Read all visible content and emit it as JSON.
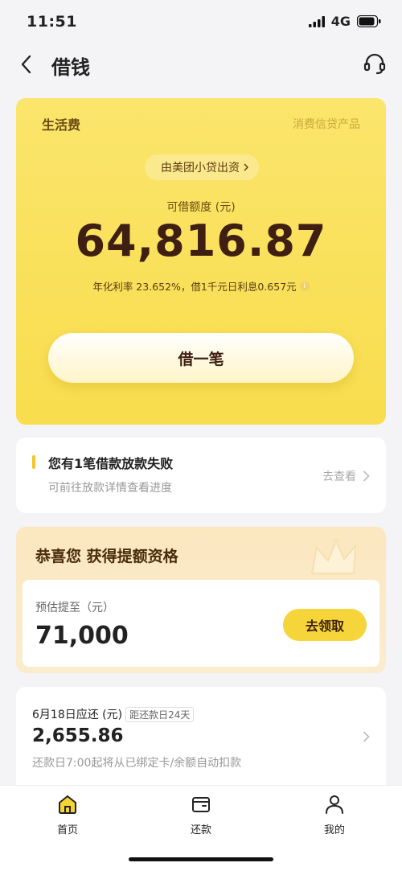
{
  "status_bar": {
    "time": "11:51",
    "network": "4G"
  },
  "header": {
    "title": "借钱"
  },
  "hero": {
    "label": "生活费",
    "tag": "消费信贷产品",
    "lender": "由美团小贷出资",
    "quota_label": "可借额度 (元)",
    "quota_amount": "64,816.87",
    "rate_text": "年化利率 23.652%，借1千元日利息0.657元",
    "borrow_button": "借一笔"
  },
  "notice": {
    "title": "您有1笔借款放款失败",
    "subtitle": "可前往放款详情查看进度",
    "link": "去查看"
  },
  "promo": {
    "title": "恭喜您 获得提额资格",
    "estimate_label": "预估提至（元）",
    "estimate_amount": "71,000",
    "claim_button": "去领取"
  },
  "repayment": {
    "due_label": "6月18日应还 (元)",
    "countdown": "距还款日24天",
    "amount": "2,655.86",
    "note": "还款日7:00起将从已绑定卡/余额自动扣款"
  },
  "tabs": [
    {
      "label": "首页",
      "icon": "home-icon"
    },
    {
      "label": "还款",
      "icon": "wallet-icon"
    },
    {
      "label": "我的",
      "icon": "user-icon"
    }
  ],
  "colors": {
    "accent": "#f8dd4d",
    "brand_dark": "#3e1f12"
  }
}
